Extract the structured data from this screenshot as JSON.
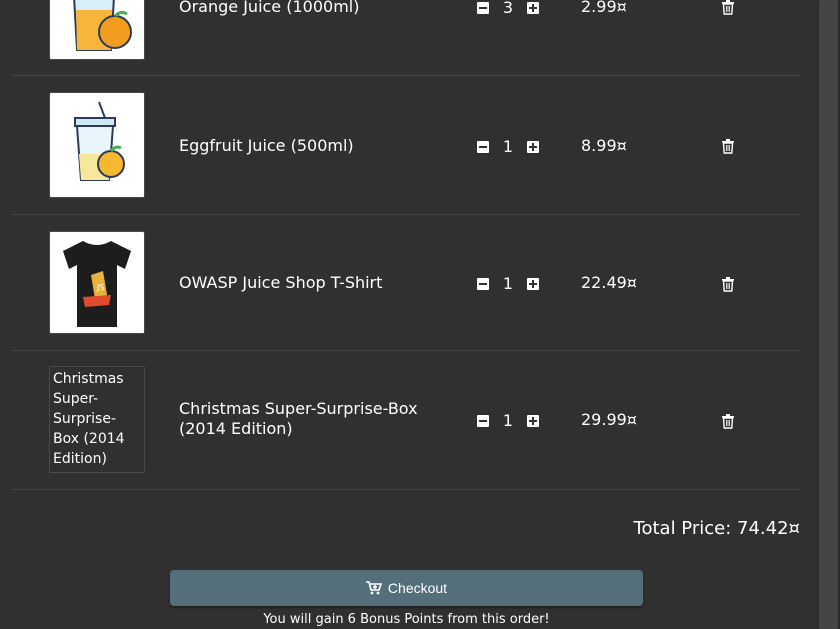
{
  "cart": {
    "items": [
      {
        "name": "Orange Juice (1000ml)",
        "quantity": "3",
        "price": "2.99¤",
        "image_alt": ""
      },
      {
        "name": "Eggfruit Juice (500ml)",
        "quantity": "1",
        "price": "8.99¤",
        "image_alt": ""
      },
      {
        "name": "OWASP Juice Shop T-Shirt",
        "quantity": "1",
        "price": "22.49¤",
        "image_alt": ""
      },
      {
        "name": "Christmas Super-Surprise-Box (2014 Edition)",
        "quantity": "1",
        "price": "29.99¤",
        "image_alt": "Christmas Super-Surprise-Box (2014 Edition)"
      }
    ],
    "total_label": "Total Price: 74.42¤",
    "checkout_label": "Checkout",
    "bonus_text": "You will gain 6 Bonus Points from this order!"
  },
  "icons": {
    "decrease": "minus-square-icon",
    "increase": "plus-square-icon",
    "remove": "trash-icon",
    "cart": "cart-plus-icon"
  },
  "colors": {
    "background": "#303030",
    "checkout_button": "#546e7a",
    "text": "#ffffff"
  }
}
